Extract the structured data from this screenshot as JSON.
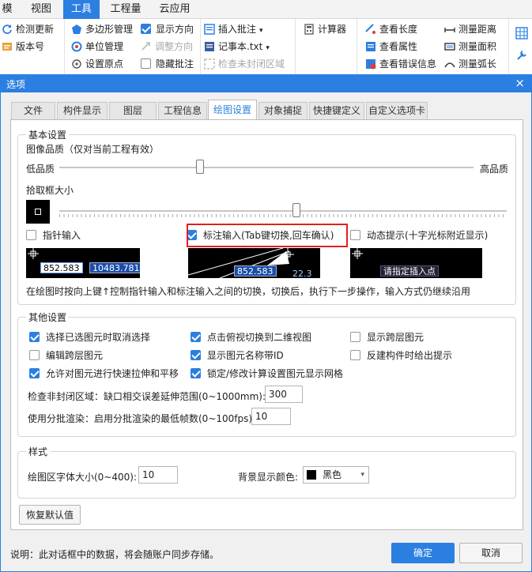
{
  "ribbon": {
    "tabs": [
      "模",
      "视图",
      "工具",
      "工程量",
      "云应用"
    ],
    "active_tab": "工具",
    "items": {
      "check_update": "检测更新",
      "version": "版本号",
      "polygon_mgmt": "多边形管理",
      "unit_mgmt": "单位管理",
      "set_origin": "设置原点",
      "show_direction": "显示方向",
      "adjust_direction": "调整方向",
      "hide_annotation": "隐藏批注",
      "insert_annotation": "插入批注",
      "notepad": "记事本.txt",
      "check_unclosed": "检查未封闭区域",
      "calculator": "计算器",
      "view_length": "查看长度",
      "view_attributes": "查看属性",
      "view_errors": "查看错误信息",
      "measure_distance": "测量距离",
      "measure_area": "测量面积",
      "measure_arc": "测量弧长"
    }
  },
  "dialog": {
    "title": "选项",
    "close": "×",
    "tabs": [
      "文件",
      "构件显示",
      "图层",
      "工程信息",
      "绘图设置",
      "对象捕捉",
      "快捷键定义",
      "自定义选项卡"
    ],
    "active_tab": "绘图设置",
    "basic": {
      "title": "基本设置",
      "quality_label": "图像品质（仅对当前工程有效）",
      "low": "低品质",
      "high": "高品质",
      "quality_value": 0.34,
      "pick_label": "拾取框大小",
      "pick_value": 0.53,
      "pointer_input": "指针输入",
      "dim_input": "标注输入(Tab键切换,回车确认)",
      "dynamic_tip": "动态提示(十字光标附近显示)",
      "preview1": {
        "a": "852.583",
        "b": "10483.781"
      },
      "preview2": {
        "a": "852.583",
        "b": "22.3"
      },
      "preview3": {
        "a": "请指定插入点"
      },
      "hint": "在绘图时按向上键↑控制指针输入和标注输入之间的切换，切换后，执行下一步操作，输入方式仍继续沿用"
    },
    "other": {
      "title": "其他设置",
      "opt1": "选择已选图元时取消选择",
      "opt2": "点击俯视切换到二维视图",
      "opt3": "显示跨层图元",
      "opt4": "编辑跨层图元",
      "opt5": "显示图元名称带ID",
      "opt6": "反建构件时给出提示",
      "opt7": "允许对图元进行快速拉伸和平移",
      "opt8": "锁定/修改计算设置图元显示网格",
      "unclosed_label": "检查非封闭区域：缺口相交误差延伸范围(0~1000mm):",
      "unclosed_value": "300",
      "batch_label": "使用分批渲染：启用分批渲染的最低帧数(0~100fps):",
      "batch_value": "10"
    },
    "style": {
      "title": "样式",
      "font_label": "绘图区字体大小(0~400):",
      "font_value": "10",
      "bg_label": "背景显示颜色:",
      "bg_value": "黑色",
      "bg_color": "#000000"
    },
    "reset": "恢复默认值",
    "footer_note": "说明：此对话框中的数据，将会随账户同步存储。",
    "ok": "确定",
    "cancel": "取消"
  },
  "colors": {
    "accent": "#2b7fe0",
    "highlight": "#e02020"
  }
}
